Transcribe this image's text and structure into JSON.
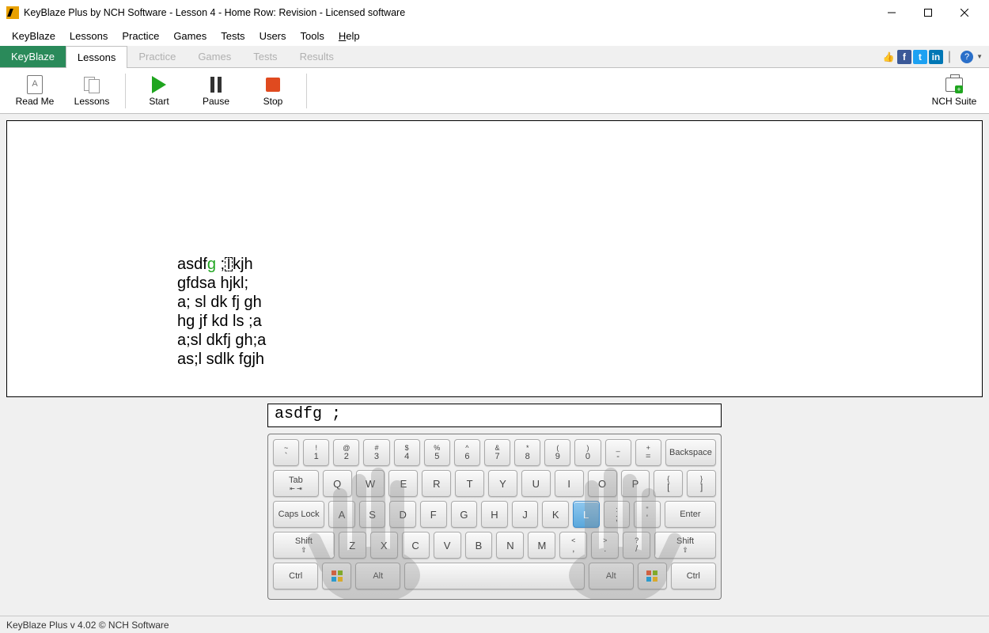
{
  "window": {
    "title": "KeyBlaze Plus by NCH Software - Lesson 4 - Home Row: Revision - Licensed software"
  },
  "menubar": {
    "items": [
      "KeyBlaze",
      "Lessons",
      "Practice",
      "Games",
      "Tests",
      "Users",
      "Tools",
      "Help"
    ],
    "help_underline_index": 7
  },
  "tabs": {
    "primary": "KeyBlaze",
    "items": [
      "Lessons",
      "Practice",
      "Games",
      "Tests",
      "Results"
    ],
    "active_index": 0
  },
  "toolbar": {
    "readme": "Read Me",
    "lessons": "Lessons",
    "start": "Start",
    "pause": "Pause",
    "stop": "Stop",
    "suite": "NCH Suite"
  },
  "lesson": {
    "typed_ok": "asdf",
    "typed_ok_tail": "g",
    "gap": " ;",
    "cursor_char": "l",
    "rest_line1": "kjh",
    "line2": "gfdsa hjkl;",
    "line3": "a; sl dk fj gh",
    "line4": "hg jf kd ls ;a",
    "line5": "a;sl dkfj gh;a",
    "line6": "as;l sdlk fgjh"
  },
  "input_echo": "asdfg ;",
  "keyboard": {
    "row1": [
      [
        "~",
        "`"
      ],
      [
        "!",
        "1"
      ],
      [
        "@",
        "2"
      ],
      [
        "#",
        "3"
      ],
      [
        "$",
        "4"
      ],
      [
        "%",
        "5"
      ],
      [
        "^",
        "6"
      ],
      [
        "&",
        "7"
      ],
      [
        "*",
        "8"
      ],
      [
        "(",
        "9"
      ],
      [
        ")",
        "0"
      ],
      [
        "_",
        "-"
      ],
      [
        "+",
        "="
      ]
    ],
    "row1_end": "Backspace",
    "row2_start": "Tab",
    "row2": [
      "Q",
      "W",
      "E",
      "R",
      "T",
      "Y",
      "U",
      "I",
      "O",
      "P"
    ],
    "row2_br": [
      [
        "{",
        "["
      ],
      [
        "}",
        "]"
      ]
    ],
    "row3_start": "Caps Lock",
    "row3": [
      "A",
      "S",
      "D",
      "F",
      "G",
      "H",
      "J",
      "K",
      "L"
    ],
    "row3_sym": [
      [
        ":",
        ";"
      ],
      [
        "\"",
        "'"
      ]
    ],
    "row3_end": "Enter",
    "row4_start": "Shift",
    "row4": [
      "Z",
      "X",
      "C",
      "V",
      "B",
      "N",
      "M"
    ],
    "row4_sym": [
      [
        "<",
        ","
      ],
      [
        ">",
        "."
      ],
      [
        "?",
        "/"
      ]
    ],
    "row4_end": "Shift",
    "row5": [
      "Ctrl",
      "",
      "Alt",
      "",
      "Alt",
      "",
      "Ctrl"
    ],
    "highlight_key": "L"
  },
  "statusbar": "KeyBlaze Plus v 4.02 © NCH Software"
}
